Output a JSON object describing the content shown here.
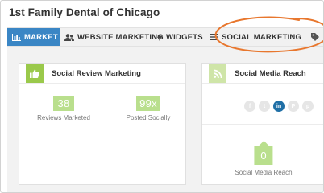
{
  "page": {
    "title": "1st Family Dental of Chicago"
  },
  "nav": {
    "tabs": [
      {
        "label": "MARKET",
        "icon": "bar-chart-icon",
        "active": true
      },
      {
        "label": "WEBSITE MARKETING",
        "icon": "users-icon",
        "active": false
      },
      {
        "label": "WIDGETS",
        "icon": "lightning-icon",
        "active": false
      },
      {
        "label": "SOCIAL MARKETING",
        "icon": "menu-icon",
        "active": false
      },
      {
        "label": "",
        "icon": "tag-icon",
        "active": false
      }
    ],
    "highlighted_tab": "SOCIAL MARKETING"
  },
  "cards": {
    "review": {
      "title": "Social Review Marketing",
      "icon": "thumbs-up-icon",
      "stats": [
        {
          "value": "38",
          "label": "Reviews Marketed"
        },
        {
          "value": "99x",
          "label": "Posted Socially"
        }
      ]
    },
    "reach": {
      "title": "Social Media Reach",
      "icon": "rss-icon",
      "networks": [
        {
          "name": "facebook-icon",
          "glyph": "f",
          "active": false
        },
        {
          "name": "twitter-icon",
          "glyph": "t",
          "active": false
        },
        {
          "name": "linkedin-icon",
          "glyph": "in",
          "active": true
        },
        {
          "name": "foursquare-icon",
          "glyph": "P",
          "active": false
        },
        {
          "name": "pinterest-icon",
          "glyph": "p",
          "active": false
        }
      ],
      "value": "0",
      "label": "Social Media Reach"
    }
  },
  "colors": {
    "nav_active": "#3a86c5",
    "stat_green": "#b9df8d",
    "icon_green": "#9ac94b",
    "highlight_orange": "#e8772e",
    "linkedin_blue": "#1f6fa6"
  }
}
